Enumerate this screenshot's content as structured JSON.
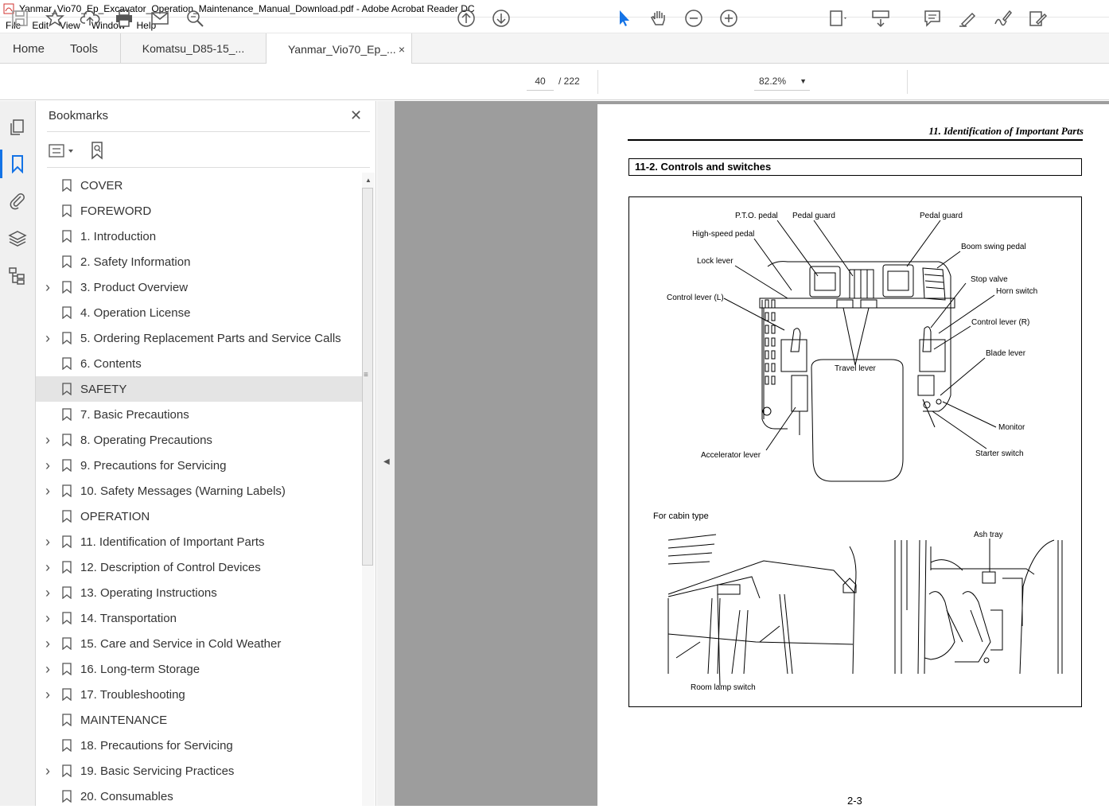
{
  "window": {
    "title": "Yanmar_Vio70_Ep_Excavator_Operation_Maintenance_Manual_Download.pdf - Adobe Acrobat Reader DC"
  },
  "menu": [
    "File",
    "Edit",
    "View",
    "Window",
    "Help"
  ],
  "tabs": {
    "home": "Home",
    "tools": "Tools",
    "doc1": "Komatsu_D85-15_...",
    "doc2": "Yanmar_Vio70_Ep_...",
    "close": "×"
  },
  "toolbar": {
    "page_current": "40",
    "page_total": "/  222",
    "zoom": "82.2%"
  },
  "panel": {
    "title": "Bookmarks",
    "close": "✕",
    "items": [
      {
        "label": "COVER",
        "expandable": false
      },
      {
        "label": "FOREWORD",
        "expandable": false
      },
      {
        "label": "1. Introduction",
        "expandable": false
      },
      {
        "label": "2. Safety Information",
        "expandable": false
      },
      {
        "label": "3. Product Overview",
        "expandable": true
      },
      {
        "label": "4. Operation License",
        "expandable": false
      },
      {
        "label": "5. Ordering Replacement Parts and Service Calls",
        "expandable": true
      },
      {
        "label": "6. Contents",
        "expandable": false
      },
      {
        "label": "SAFETY",
        "expandable": false,
        "selected": true
      },
      {
        "label": "7. Basic Precautions",
        "expandable": false
      },
      {
        "label": "8. Operating Precautions",
        "expandable": true
      },
      {
        "label": "9. Precautions for Servicing",
        "expandable": true
      },
      {
        "label": "10. Safety Messages (Warning Labels)",
        "expandable": true
      },
      {
        "label": "OPERATION",
        "expandable": false
      },
      {
        "label": "11. Identification of Important Parts",
        "expandable": true
      },
      {
        "label": "12. Description of Control Devices",
        "expandable": true
      },
      {
        "label": "13. Operating Instructions",
        "expandable": true
      },
      {
        "label": "14. Transportation",
        "expandable": true
      },
      {
        "label": "15. Care and Service in Cold Weather",
        "expandable": true
      },
      {
        "label": "16. Long-term Storage",
        "expandable": true
      },
      {
        "label": "17. Troubleshooting",
        "expandable": true
      },
      {
        "label": "MAINTENANCE",
        "expandable": false
      },
      {
        "label": "18. Precautions for Servicing",
        "expandable": false
      },
      {
        "label": "19. Basic Servicing Practices",
        "expandable": true
      },
      {
        "label": "20. Consumables",
        "expandable": false
      }
    ]
  },
  "document": {
    "header": "11. Identification of Important Parts",
    "section": "11-2. Controls and switches",
    "labels": {
      "pto_pedal": "P.T.O. pedal",
      "pedal_guard_l": "Pedal guard",
      "pedal_guard_r": "Pedal guard",
      "high_speed_pedal": "High-speed pedal",
      "boom_swing_pedal": "Boom swing pedal",
      "lock_lever": "Lock lever",
      "stop_valve": "Stop valve",
      "horn_switch": "Horn switch",
      "control_lever_l": "Control lever (L)",
      "control_lever_r": "Control lever (R)",
      "blade_lever": "Blade lever",
      "travel_lever": "Travel lever",
      "monitor": "Monitor",
      "accelerator_lever": "Accelerator lever",
      "starter_switch": "Starter switch",
      "cabin_type": "For cabin type",
      "ash_tray": "Ash tray",
      "room_lamp_switch": "Room lamp switch"
    },
    "page_number": "2-3"
  }
}
